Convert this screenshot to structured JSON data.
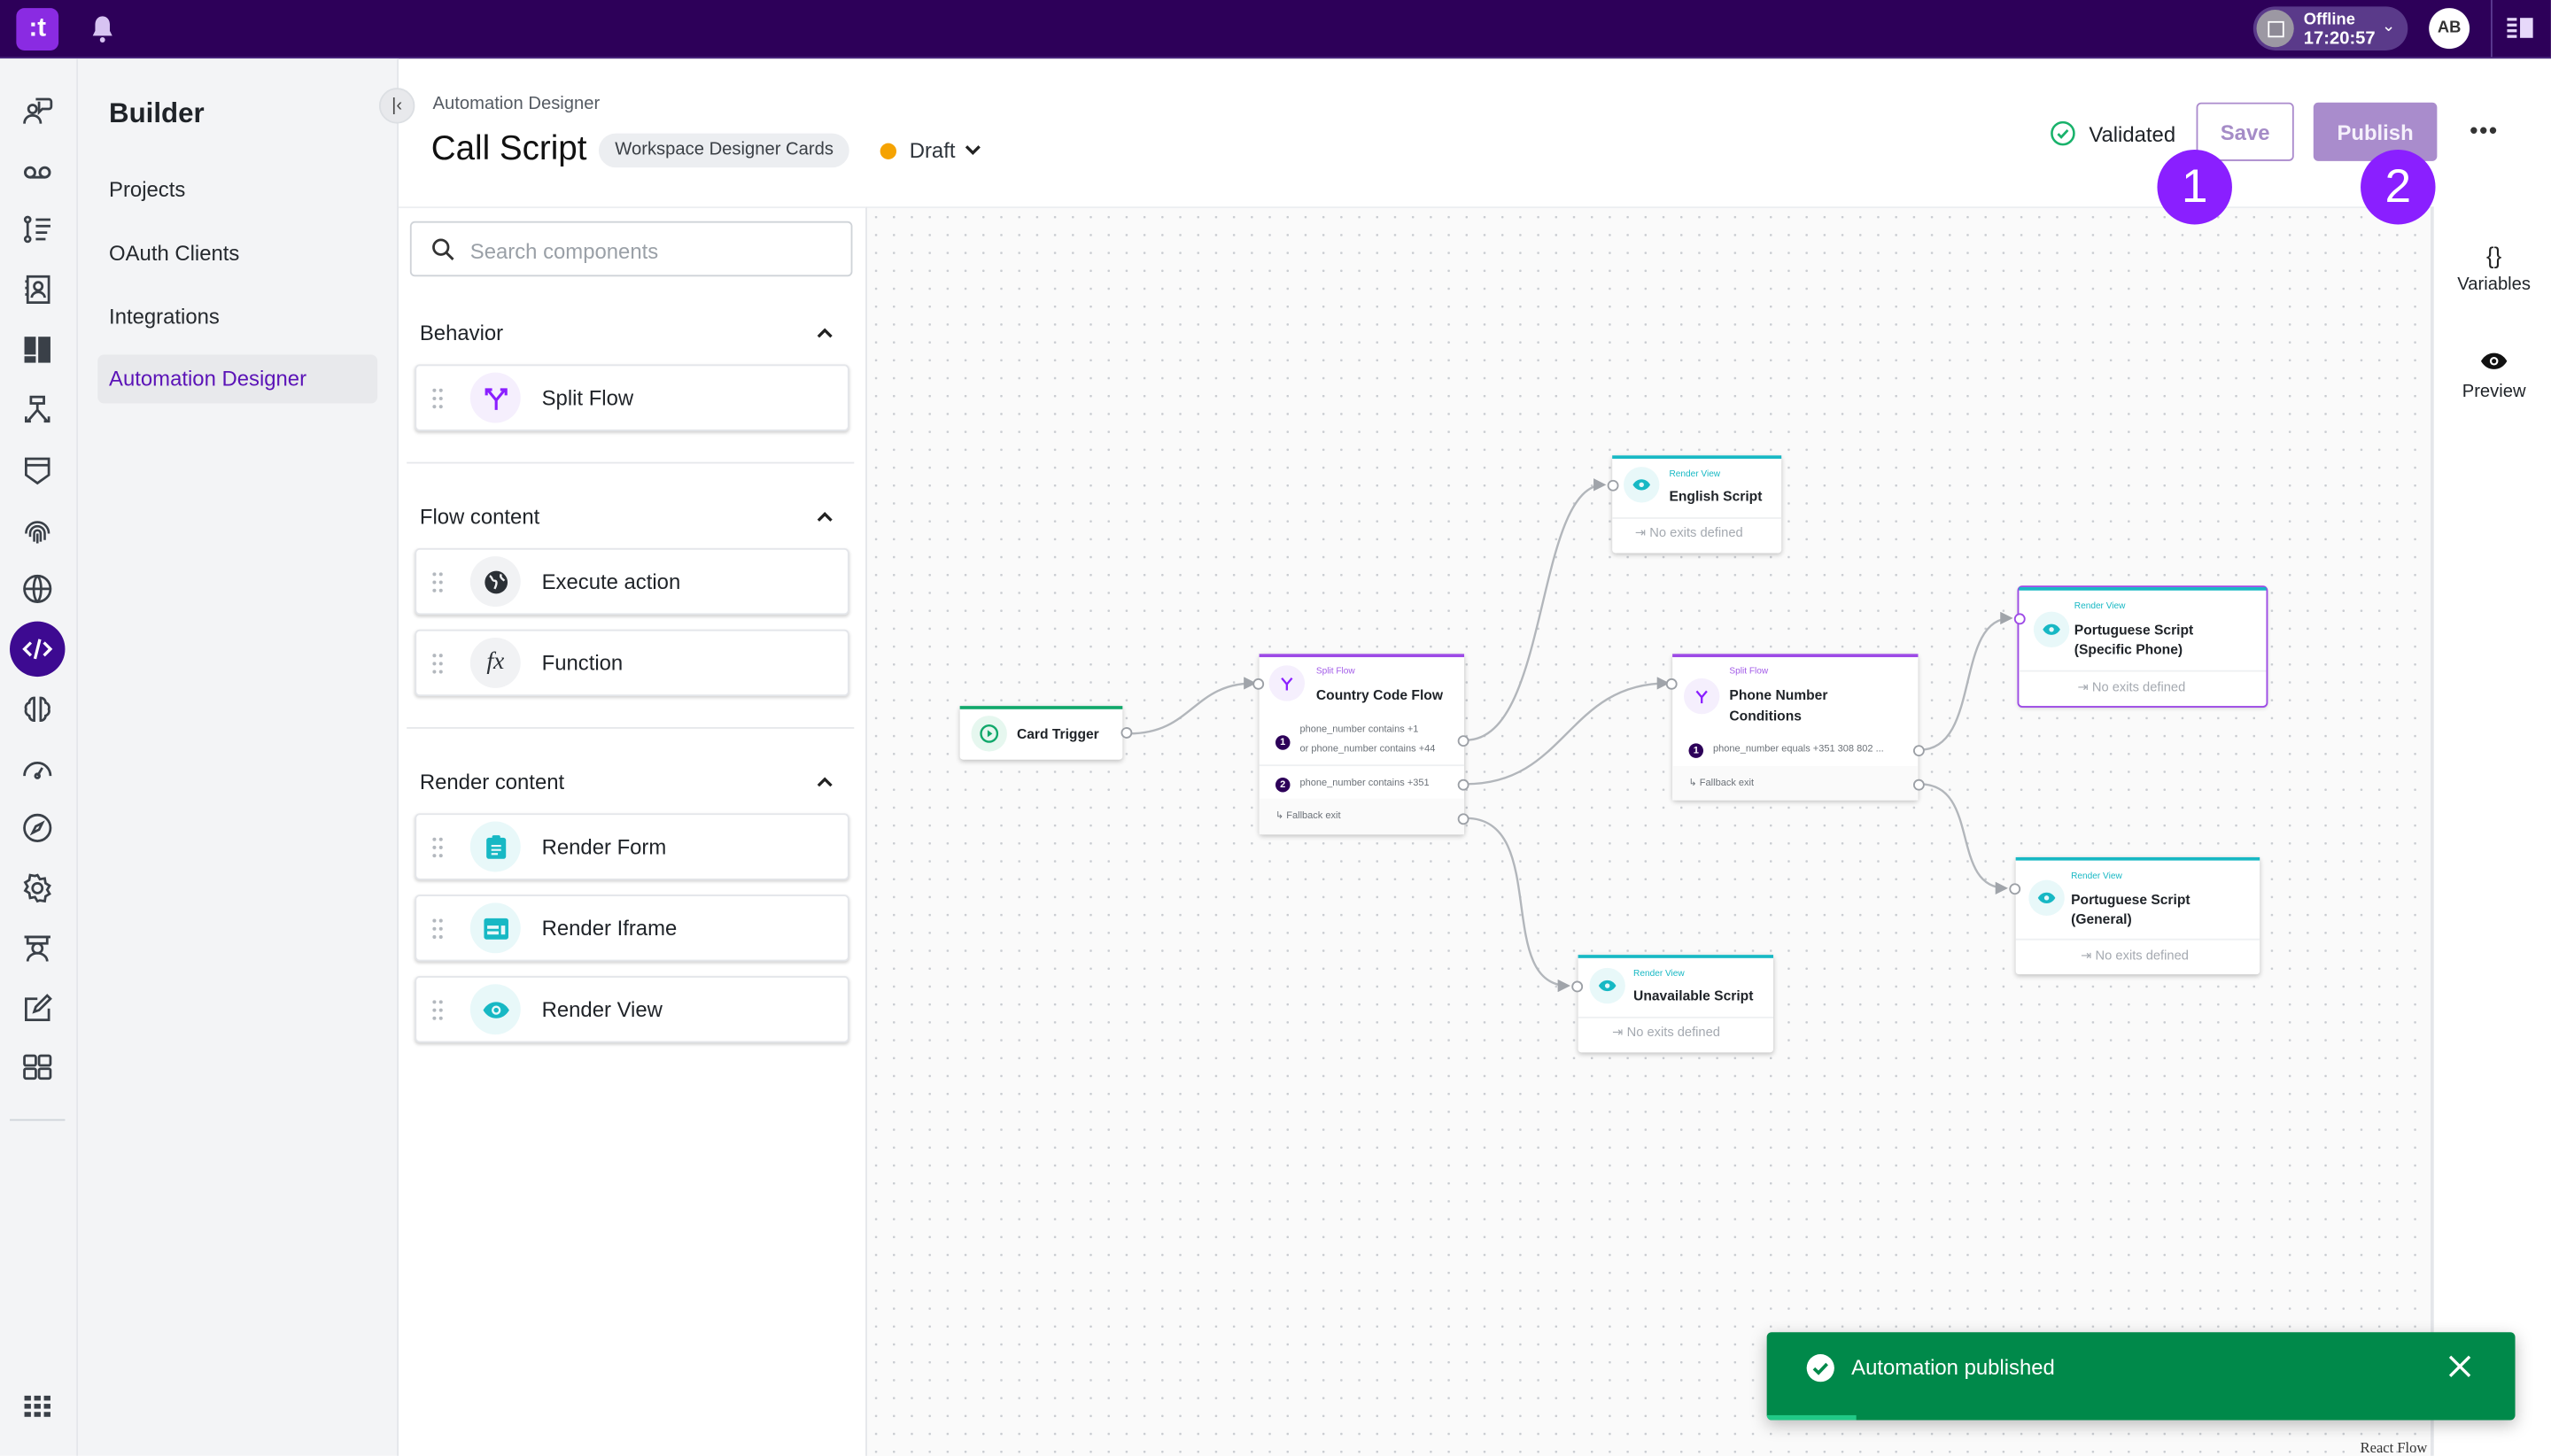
{
  "topbar": {
    "logo_text": ":t",
    "status": {
      "label": "Offline",
      "time": "17:20:57"
    },
    "avatar_initials": "AB"
  },
  "rail": {
    "icons": [
      "agent-chat-icon",
      "voicemail-icon",
      "flow-list-icon",
      "contacts-icon",
      "dashboard-icon",
      "routing-icon",
      "shield-icon",
      "fingerprint-icon",
      "globe-icon",
      "code-icon",
      "brain-icon",
      "speedometer-icon",
      "compass-icon",
      "gear-icon",
      "supervisor-icon",
      "edit-icon",
      "widgets-icon"
    ],
    "active": "code-icon",
    "apps_icon": "apps-grid-icon"
  },
  "nav": {
    "title": "Builder",
    "items": [
      {
        "label": "Projects",
        "active": false
      },
      {
        "label": "OAuth Clients",
        "active": false
      },
      {
        "label": "Integrations",
        "active": false
      },
      {
        "label": "Automation Designer",
        "active": true
      }
    ]
  },
  "header": {
    "breadcrumb": "Automation Designer",
    "title": "Call Script",
    "tag": "Workspace Designer Cards",
    "status": "Draft",
    "status_color": "#f5a302",
    "validation": "Validated",
    "save_label": "Save",
    "publish_label": "Publish",
    "more_label": "•••",
    "callouts": [
      "1",
      "2"
    ]
  },
  "components": {
    "search_placeholder": "Search components",
    "groups": [
      {
        "title": "Behavior",
        "items": [
          {
            "label": "Split Flow",
            "icon": "split-icon"
          }
        ]
      },
      {
        "title": "Flow content",
        "items": [
          {
            "label": "Execute action",
            "icon": "globe-icon"
          },
          {
            "label": "Function",
            "icon": "function-icon"
          }
        ]
      },
      {
        "title": "Render content",
        "items": [
          {
            "label": "Render Form",
            "icon": "form-icon"
          },
          {
            "label": "Render Iframe",
            "icon": "iframe-icon"
          },
          {
            "label": "Render View",
            "icon": "eye-icon"
          }
        ]
      }
    ]
  },
  "flow": {
    "nodes": {
      "trigger": {
        "title": "Card Trigger"
      },
      "country": {
        "kind": "Split Flow",
        "title": "Country Code Flow",
        "conditions": [
          {
            "num": "1",
            "lines": [
              "phone_number contains +1",
              "or phone_number contains +44"
            ]
          },
          {
            "num": "2",
            "lines": [
              "phone_number contains +351"
            ]
          }
        ],
        "fallback": "Fallback exit"
      },
      "english": {
        "kind": "Render View",
        "title": "English Script",
        "exits": "No exits defined"
      },
      "phone": {
        "kind": "Split Flow",
        "title_lines": [
          "Phone Number",
          "Conditions"
        ],
        "conditions": [
          {
            "num": "1",
            "lines": [
              "phone_number equals +351 308 802 ..."
            ]
          }
        ],
        "fallback": "Fallback exit"
      },
      "pt_specific": {
        "kind": "Render View",
        "title_lines": [
          "Portuguese Script",
          "(Specific Phone)"
        ],
        "exits": "No exits defined",
        "selected": true
      },
      "pt_general": {
        "kind": "Render View",
        "title_lines": [
          "Portuguese Script",
          "(General)"
        ],
        "exits": "No exits defined"
      },
      "unavailable": {
        "kind": "Render View",
        "title": "Unavailable Script",
        "exits": "No exits defined"
      }
    },
    "attribution": "React Flow"
  },
  "right_rail": {
    "items": [
      {
        "label": "Variables",
        "icon": "{}"
      },
      {
        "label": "Preview",
        "icon": "eye-icon"
      }
    ]
  },
  "toast": {
    "message": "Automation published",
    "progress_percent": 12
  },
  "colors": {
    "brand": "#2d0059",
    "accent": "#8a1fff",
    "split": "#9d4ae6",
    "render": "#17b8c4",
    "trigger": "#11a86b",
    "success": "#00894a"
  }
}
